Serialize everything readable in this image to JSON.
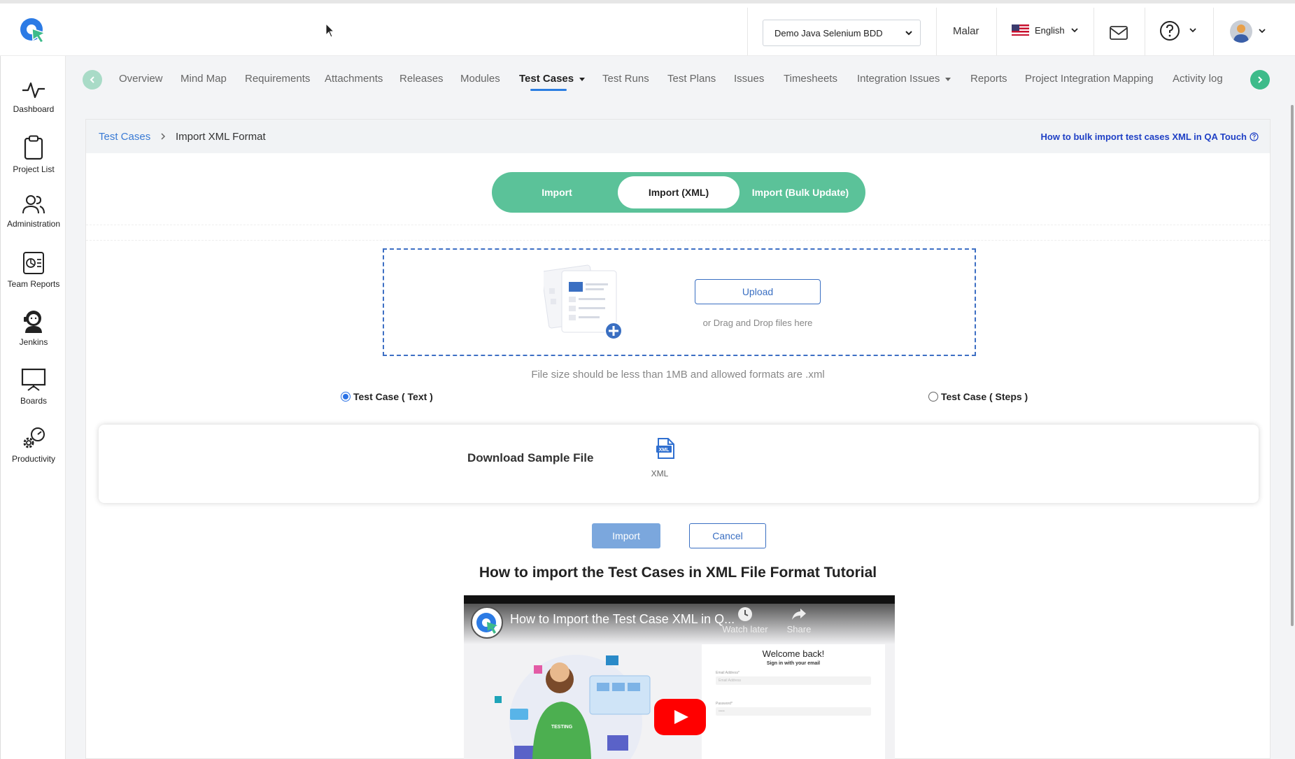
{
  "header": {
    "project_select": "Demo Java Selenium BDD",
    "user_name": "Malar",
    "language": "English"
  },
  "sidebar": {
    "items": [
      {
        "label": "Dashboard",
        "icon": "activity-icon"
      },
      {
        "label": "Project List",
        "icon": "clipboard-icon"
      },
      {
        "label": "Administration",
        "icon": "users-icon"
      },
      {
        "label": "Team Reports",
        "icon": "report-icon"
      },
      {
        "label": "Jenkins",
        "icon": "jenkins-icon"
      },
      {
        "label": "Boards",
        "icon": "board-icon"
      },
      {
        "label": "Productivity",
        "icon": "gears-icon"
      }
    ]
  },
  "tabs": {
    "items": [
      {
        "label": "Overview"
      },
      {
        "label": "Mind Map"
      },
      {
        "label": "Requirements"
      },
      {
        "label": "Attachments"
      },
      {
        "label": "Releases"
      },
      {
        "label": "Modules"
      },
      {
        "label": "Test Cases",
        "active": true,
        "dropdown": true
      },
      {
        "label": "Test Runs"
      },
      {
        "label": "Test Plans"
      },
      {
        "label": "Issues"
      },
      {
        "label": "Timesheets"
      },
      {
        "label": "Integration Issues",
        "dropdown": true
      },
      {
        "label": "Reports"
      },
      {
        "label": "Project Integration Mapping"
      },
      {
        "label": "Activity log"
      }
    ]
  },
  "breadcrumb": {
    "parent": "Test Cases",
    "current": "Import XML Format"
  },
  "help_link": "How to bulk import test cases XML in QA Touch",
  "import_modes": {
    "options": [
      "Import",
      "Import (XML)",
      "Import (Bulk Update)"
    ],
    "selected": "Import (XML)"
  },
  "upload": {
    "button": "Upload",
    "drag_text": "or Drag and Drop files here",
    "hint": "File size should be less than 1MB and allowed formats are .xml"
  },
  "radio_options": [
    {
      "label": "Test Case ( Text )",
      "checked": true
    },
    {
      "label": "Test Case ( Steps )",
      "checked": false
    }
  ],
  "sample": {
    "label": "Download Sample File",
    "file_type": "XML"
  },
  "actions": {
    "import": "Import",
    "cancel": "Cancel"
  },
  "tutorial": {
    "title": "How to import the Test Cases in XML File Format Tutorial",
    "video_title": "How to Import the Test Case XML in Q...",
    "watch_later": "Watch later",
    "share": "Share",
    "welcome": "Welcome back!",
    "signin": "Sign in with your email",
    "email_label": "Email Address*",
    "email_placeholder": "Email Address",
    "password_label": "Password*",
    "password_value": "•••••",
    "shirt_text": "TESTING"
  },
  "colors": {
    "accent_green": "#5bc299",
    "primary_blue": "#3a6fc2",
    "link_blue": "#1f40c5"
  }
}
